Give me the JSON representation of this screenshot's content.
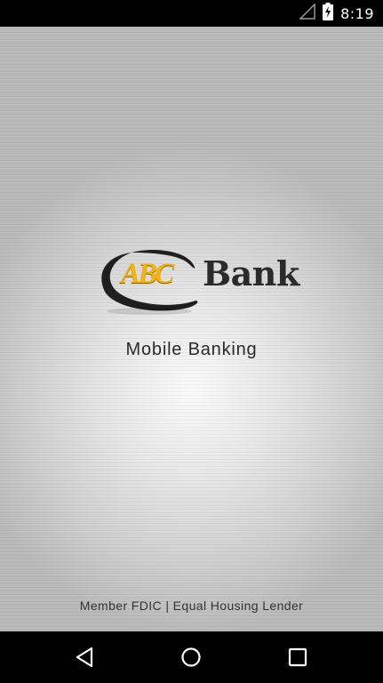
{
  "status_bar": {
    "time": "8:19",
    "icons": [
      "signal-icon",
      "battery-charging-icon"
    ]
  },
  "splash": {
    "logo": {
      "abc": "ABC",
      "bank": "Bank"
    },
    "subtitle": "Mobile Banking",
    "footer": "Member FDIC | Equal Housing Lender"
  },
  "nav_bar": {
    "buttons": [
      "back-icon",
      "home-icon",
      "recents-icon"
    ]
  },
  "colors": {
    "logo_gold": "#f2b20f",
    "logo_dark": "#2b2b2b",
    "bar_background": "#000000"
  }
}
